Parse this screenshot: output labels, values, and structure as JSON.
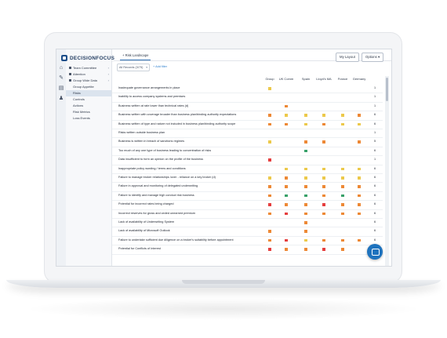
{
  "brand": {
    "name": "DECISIONFOCUS"
  },
  "tabs": [
    {
      "label": "Risk Landscape"
    }
  ],
  "toolbar": {
    "layout_label": "My Layout",
    "options_label": "Options"
  },
  "filter": {
    "records_label": "All Records (3/75)",
    "add_filter_label": "+ Add filter"
  },
  "sidebar": {
    "items": [
      {
        "label": "Team Committee",
        "has_caret": true,
        "level": 0
      },
      {
        "label": "Attention",
        "has_caret": true,
        "level": 0
      },
      {
        "label": "Group Wide Data",
        "has_caret": true,
        "level": 0
      },
      {
        "label": "Group Appetite",
        "has_caret": false,
        "level": 1
      },
      {
        "label": "Risks",
        "has_caret": false,
        "level": 1,
        "active": true
      },
      {
        "label": "Controls",
        "has_caret": false,
        "level": 1
      },
      {
        "label": "Actions",
        "has_caret": false,
        "level": 1
      },
      {
        "label": "Risk Metrics",
        "has_caret": false,
        "level": 1
      },
      {
        "label": "Loss Events",
        "has_caret": false,
        "level": 1
      }
    ]
  },
  "rail_icons": [
    "home-icon",
    "tools-icon",
    "chart-icon",
    "user-icon"
  ],
  "colors": {
    "red": "#e53e3e",
    "orange": "#ed8936",
    "yellow": "#ecc94b",
    "green": "#38a169",
    "accent": "#1e73be"
  },
  "columns": [
    "Group",
    "UK Comm",
    "Spain",
    "Lloyd's MA",
    "France",
    "Germany"
  ],
  "rows": [
    {
      "label": "Inadequate governance arrangements in place",
      "cells": [
        "yellow",
        "",
        "",
        "",
        "",
        ""
      ],
      "count": "1"
    },
    {
      "label": "Inability to access company systems and premises",
      "cells": [
        "",
        "",
        "",
        "",
        "",
        ""
      ],
      "count": "1"
    },
    {
      "label": "Business written at rate lower than technical rates (d)",
      "cells": [
        "",
        "orange",
        "",
        "",
        "",
        ""
      ],
      "count": "1"
    },
    {
      "label": "Business written with coverage broader than business plan/binding authority expectations",
      "cells": [
        "orange",
        "yellow",
        "yellow",
        "yellow",
        "yellow",
        "orange"
      ],
      "count": "6"
    },
    {
      "label": "Business written of type and nature not included in business plan/binding authority scope",
      "cells": [
        "orange",
        "orange",
        "yellow",
        "orange",
        "yellow",
        "yellow"
      ],
      "count": "6"
    },
    {
      "label": "Risks written outside business plan",
      "cells": [
        "",
        "",
        "",
        "",
        "",
        ""
      ],
      "count": "1"
    },
    {
      "label": "Business is written in breach of sanctions regimes",
      "cells": [
        "yellow",
        "",
        "orange",
        "orange",
        "",
        "orange"
      ],
      "count": "5"
    },
    {
      "label": "Too much of any one type of business leading to concentration of risks",
      "cells": [
        "",
        "",
        "green",
        "",
        "",
        ""
      ],
      "count": "6"
    },
    {
      "label": "Data insufficient to form an opinion on the profile of the business",
      "cells": [
        "red",
        "",
        "",
        "",
        "",
        ""
      ],
      "count": "1"
    },
    {
      "label": "Inappropriate policy wording / terms and conditions",
      "cells": [
        "",
        "yellow",
        "yellow",
        "yellow",
        "yellow",
        "yellow"
      ],
      "count": "6"
    },
    {
      "label": "Failure to manage broker relationships /over - reliance on a key broker (d)",
      "cells": [
        "yellow",
        "orange",
        "yellow",
        "yellow",
        "yellow",
        "yellow"
      ],
      "count": "6"
    },
    {
      "label": "Failure in approval and monitoring of delegated underwriting",
      "cells": [
        "orange",
        "orange",
        "orange",
        "orange",
        "orange",
        "orange"
      ],
      "count": "6"
    },
    {
      "label": "Failure to identify and manage high conduct risk business",
      "cells": [
        "orange",
        "green",
        "green",
        "orange",
        "green",
        "orange"
      ],
      "count": "6"
    },
    {
      "label": "Potential for incorrect rates being charged",
      "cells": [
        "red",
        "orange",
        "orange",
        "red",
        "orange",
        "orange"
      ],
      "count": "6"
    },
    {
      "label": "Incorrect reserves for gross and ceded unearned premium",
      "cells": [
        "orange",
        "red",
        "orange",
        "orange",
        "orange",
        "orange"
      ],
      "count": "6"
    },
    {
      "label": "Lack of availability of Underwriting System",
      "cells": [
        "",
        "",
        "orange",
        "",
        "",
        ""
      ],
      "count": "6"
    },
    {
      "label": "Lack of availability of Microsoft Outlook",
      "cells": [
        "orange",
        "",
        "orange",
        "",
        "",
        ""
      ],
      "count": "6"
    },
    {
      "label": "Failure to undertake sufficient due diligence on a broker's suitability before appointment",
      "cells": [
        "orange",
        "red",
        "yellow",
        "orange",
        "orange",
        "orange"
      ],
      "count": "6"
    },
    {
      "label": "Potential for Conflicts of Interest",
      "cells": [
        "red",
        "orange",
        "orange",
        "red",
        "orange",
        ""
      ],
      "count": "6"
    }
  ]
}
